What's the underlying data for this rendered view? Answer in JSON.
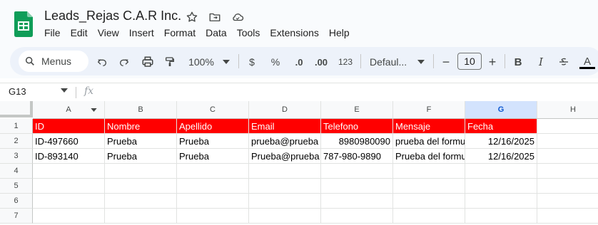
{
  "app": {
    "doc_title": "Leads_Rejas C.A.R Inc.",
    "icons": [
      "star-icon",
      "move-to-folder-icon",
      "cloud-saved-icon"
    ]
  },
  "menu": [
    "File",
    "Edit",
    "View",
    "Insert",
    "Format",
    "Data",
    "Tools",
    "Extensions",
    "Help"
  ],
  "toolbar": {
    "search_label": "Menus",
    "zoom": "100%",
    "currency": "$",
    "percent": "%",
    "decrease_decimal": ".0",
    "increase_decimal": ".00",
    "number_format": "123",
    "font": "Defaul...",
    "font_size": "10",
    "minus": "−",
    "plus": "+",
    "bold": "B",
    "italic": "I",
    "text_color": "A"
  },
  "formula_bar": {
    "cell_ref": "G13",
    "fx": "fx",
    "value": ""
  },
  "sheet": {
    "columns": [
      "A",
      "B",
      "C",
      "D",
      "E",
      "F",
      "G",
      "H"
    ],
    "selected_column": "G",
    "row_numbers": [
      "1",
      "2",
      "3",
      "4",
      "5",
      "6",
      "7"
    ],
    "header_fill": "#ff0000",
    "header_row": [
      "ID",
      "Nombre",
      "Apellido",
      "Email",
      "Telefono",
      "Mensaje",
      "Fecha"
    ],
    "rows": [
      [
        "ID-497660",
        "Prueba",
        "Prueba",
        "prueba@prueba",
        "8980980090",
        "prueba del formu",
        "12/16/2025"
      ],
      [
        "ID-893140",
        "Prueba",
        "Prueba",
        "Prueba@prueba",
        "787-980-9890",
        "Prueba del formu",
        "12/16/2025"
      ]
    ]
  }
}
